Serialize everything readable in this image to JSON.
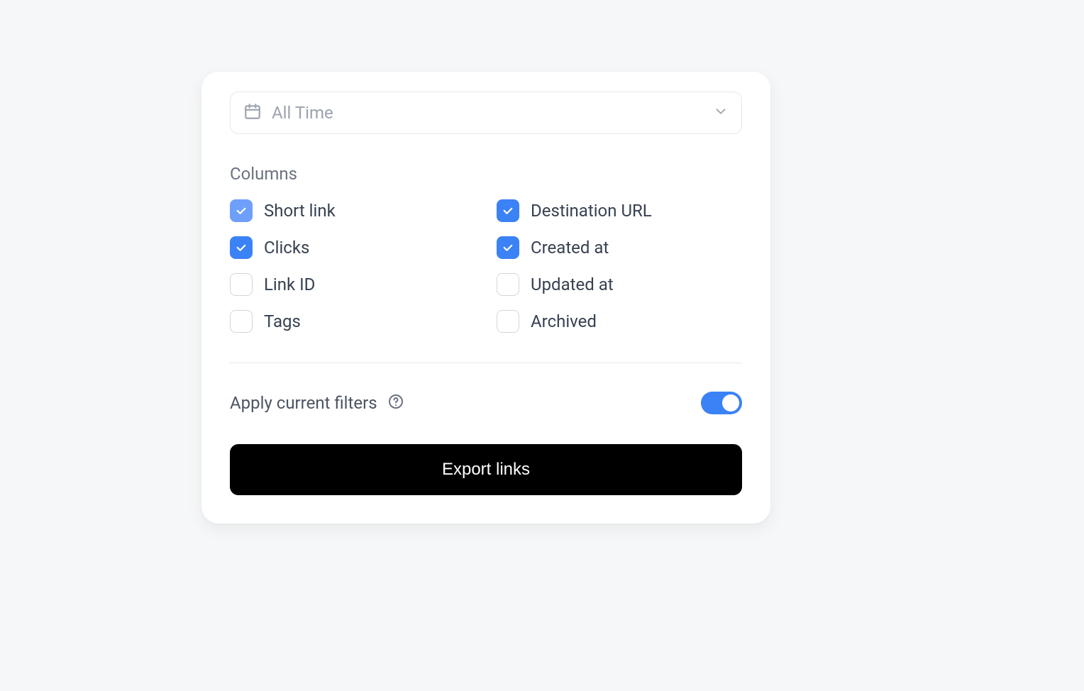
{
  "timeRange": {
    "label": "All Time"
  },
  "columns": {
    "sectionLabel": "Columns",
    "items": [
      {
        "label": "Short link",
        "checked": true,
        "lighter": true
      },
      {
        "label": "Destination URL",
        "checked": true,
        "lighter": false
      },
      {
        "label": "Clicks",
        "checked": true,
        "lighter": false
      },
      {
        "label": "Created at",
        "checked": true,
        "lighter": false
      },
      {
        "label": "Link ID",
        "checked": false,
        "lighter": false
      },
      {
        "label": "Updated at",
        "checked": false,
        "lighter": false
      },
      {
        "label": "Tags",
        "checked": false,
        "lighter": false
      },
      {
        "label": "Archived",
        "checked": false,
        "lighter": false
      }
    ]
  },
  "filters": {
    "label": "Apply current filters",
    "enabled": true
  },
  "exportButton": {
    "label": "Export links"
  }
}
